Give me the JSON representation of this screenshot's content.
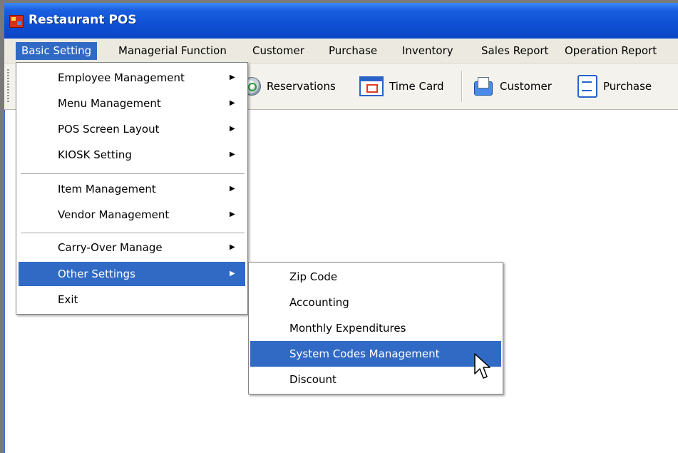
{
  "window": {
    "title": "Restaurant POS"
  },
  "menubar": {
    "items": [
      {
        "label": "Basic Setting",
        "active": true
      },
      {
        "label": "Managerial Function"
      },
      {
        "label": "Customer"
      },
      {
        "label": "Purchase"
      },
      {
        "label": "Inventory"
      },
      {
        "label": "Sales Report"
      },
      {
        "label": "Operation Report"
      }
    ]
  },
  "toolbar": {
    "buttons": [
      {
        "label": "Reservations",
        "icon": "clock-icon"
      },
      {
        "label": "Time Card",
        "icon": "calendar-icon"
      },
      {
        "label": "Customer",
        "icon": "customer-icon"
      },
      {
        "label": "Purchase",
        "icon": "document-icon"
      }
    ]
  },
  "dropdown": {
    "items": [
      {
        "label": "Employee Management",
        "arrow": "▶"
      },
      {
        "label": "Menu Management",
        "arrow": "▶"
      },
      {
        "label": "POS Screen Layout",
        "arrow": "▶"
      },
      {
        "label": "KIOSK Setting",
        "arrow": "▶"
      },
      {
        "label": "Item Management",
        "arrow": "▶"
      },
      {
        "label": "Vendor Management",
        "arrow": "▶"
      },
      {
        "label": "Carry-Over Manage",
        "arrow": "▶"
      },
      {
        "label": "Other Settings",
        "arrow": "▶",
        "highlighted": true
      },
      {
        "label": "Exit"
      }
    ]
  },
  "submenu": {
    "items": [
      {
        "label": "Zip Code"
      },
      {
        "label": "Accounting"
      },
      {
        "label": "Monthly Expenditures"
      },
      {
        "label": "System Codes Management",
        "highlighted": true
      },
      {
        "label": "Discount"
      }
    ]
  },
  "colors": {
    "highlight": "#316ac5",
    "titlebar": "#0f4fd3",
    "menubar": "#eceae0"
  }
}
